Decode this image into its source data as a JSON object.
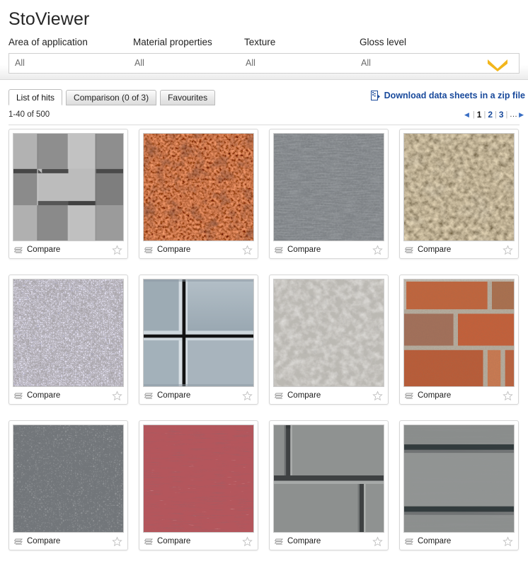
{
  "header": {
    "app_title": "StoViewer",
    "filters": [
      {
        "label": "Area of application",
        "value": "All"
      },
      {
        "label": "Material properties",
        "value": "All"
      },
      {
        "label": "Texture",
        "value": "All"
      },
      {
        "label": "Gloss level",
        "value": "All"
      }
    ],
    "expand_icon": "chevron-down-icon",
    "chevron_color": "#f2b61c"
  },
  "tabs": [
    {
      "label": "List of hits",
      "active": true
    },
    {
      "label": "Comparison (0 of 3)",
      "active": false
    },
    {
      "label": "Favourites",
      "active": false
    }
  ],
  "download": {
    "label": "Download data sheets in a zip file",
    "icon": "zip-file-icon",
    "color": "#18499b"
  },
  "results": {
    "count_text": "1-40 of 500",
    "pagination": {
      "prev_icon": "triangle-left-icon",
      "next_icon": "triangle-right-icon",
      "pages": [
        "1",
        "2",
        "3"
      ],
      "current_page": "1",
      "ellipsis": "...",
      "separator": "|"
    }
  },
  "cards": [
    {
      "texture": "grey-3d-offset-cube-panels",
      "compare_label": "Compare",
      "compare_icon": "compare-icon",
      "favourite_icon": "star-outline-icon"
    },
    {
      "texture": "orange-brown-polished-granite",
      "compare_label": "Compare",
      "compare_icon": "compare-icon",
      "favourite_icon": "star-outline-icon"
    },
    {
      "texture": "grey-scratched-render",
      "compare_label": "Compare",
      "compare_icon": "compare-icon",
      "favourite_icon": "star-outline-icon"
    },
    {
      "texture": "beige-exposed-aggregate-stone",
      "compare_label": "Compare",
      "compare_icon": "compare-icon",
      "favourite_icon": "star-outline-icon"
    },
    {
      "texture": "blue-grey-pebble-chippings",
      "compare_label": "Compare",
      "compare_icon": "compare-icon",
      "favourite_icon": "star-outline-icon"
    },
    {
      "texture": "blue-grey-panel-cross-joint",
      "compare_label": "Compare",
      "compare_icon": "compare-icon",
      "favourite_icon": "star-outline-icon"
    },
    {
      "texture": "light-grey-rough-plaster",
      "compare_label": "Compare",
      "compare_icon": "compare-icon",
      "favourite_icon": "star-outline-icon"
    },
    {
      "texture": "red-brown-brickwork",
      "compare_label": "Compare",
      "compare_icon": "compare-icon",
      "favourite_icon": "star-outline-icon"
    },
    {
      "texture": "dark-grey-stippled-render",
      "compare_label": "Compare",
      "compare_icon": "compare-icon",
      "favourite_icon": "star-outline-icon"
    },
    {
      "texture": "red-horizontal-scored-render",
      "compare_label": "Compare",
      "compare_icon": "compare-icon",
      "favourite_icon": "star-outline-icon"
    },
    {
      "texture": "grey-3d-recessed-joint-panels",
      "compare_label": "Compare",
      "compare_icon": "compare-icon",
      "favourite_icon": "star-outline-icon"
    },
    {
      "texture": "grey-horizontal-wood-grain-cladding",
      "compare_label": "Compare",
      "compare_icon": "compare-icon",
      "favourite_icon": "star-outline-icon"
    }
  ]
}
